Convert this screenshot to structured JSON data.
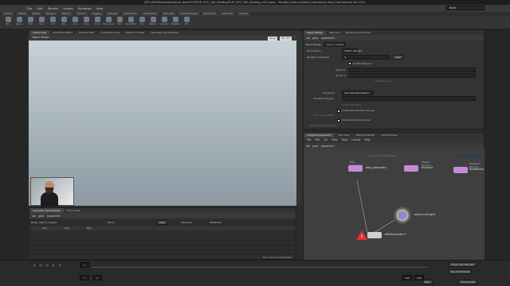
{
  "window": {
    "title": "/JETLAG/Work/sdsdn/work_files/FLIP/FLIP_020_160_Melting/FLIP_020_160_Melting_v01.hipnc - Houdini Indie Limited-Commercial Non-Commercial 16.5.311"
  },
  "menu": [
    "File",
    "Edit",
    "Render",
    "Assets",
    "Windows",
    "Help"
  ],
  "build_label": "Build",
  "shelf_tabs": [
    "Create",
    "Modify",
    "Model",
    "Polygon",
    "Deform",
    "Texture",
    "Rigging",
    "Muscles",
    "Characters",
    "Constraints",
    "Hair Utils",
    "Guide Process",
    "Terrain FX",
    "Cloud FX",
    "Volume"
  ],
  "shelf_icons": [
    "Box",
    "Sphere",
    "Tube",
    "Torus",
    "Grid",
    "Null",
    "Line",
    "Circle",
    "Curve",
    "Draw Curve",
    "Path",
    "Spray Paint",
    "Font",
    "Platonic",
    "L-System",
    "Metaball",
    "File"
  ],
  "viewport": {
    "tabs": [
      "Scene View",
      "Animation Editor",
      "Render View",
      "Composite View",
      "Motion FX View",
      "Geometry Spreadsheet"
    ],
    "path": [
      "obj",
      "geo1",
      "sopsolver1"
    ],
    "title": "Object Merge",
    "persp_label": "Persp",
    "cam_label": "No cam",
    "footer": "Non-Commercial Edition"
  },
  "params": {
    "tabs": [
      "Object Merge",
      "Take List",
      "Performance Monitor"
    ],
    "path": [
      "obj",
      "geo1",
      "sopsolver1"
    ],
    "node_type": "Object Merge",
    "node_name": "object_merge1",
    "node_name_label": "Node Name",
    "num_objects_label": "Number of Objects",
    "num_objects_value": "1",
    "clear_label": "Clear",
    "enable_merge_label": "Enable Merge 1",
    "object1_label": "Object 1",
    "group1_label": "Group 1",
    "expand_label": "Expand Group",
    "transform_label": "Transform",
    "transform_value": "Into Specified Object",
    "transform_object_label": "Transform Object",
    "invert_label": "Invert Transform",
    "create_per_prim_label": "Create Per-Primitive Groups",
    "create_prim_groups_label": "Create Primitive Groups",
    "prim_group_prefix_label": "Prim Group Prefix",
    "number_groups_label": "Number Groups Prefix"
  },
  "network": {
    "tabs": [
      "/obj/geo1/sopsolver1",
      "Tree View",
      "Material Palette",
      "Asset Browser"
    ],
    "menu": [
      "File",
      "Edit",
      "Go",
      "View",
      "Tools",
      "Layout",
      "Help"
    ],
    "path": [
      "obj",
      "geo1",
      "sopsolver1"
    ],
    "context_caption": "Non-Commercial Edition",
    "context_word": "Geometry",
    "nodes": [
      {
        "name": "dop_geometry",
        "caption": "Dop Geometry",
        "color": "#c58ad6",
        "kind": "input"
      },
      {
        "name": "impacts",
        "caption": "Impact Records",
        "color": "#c58ad6",
        "kind": "input"
      },
      {
        "name": "feedbacks",
        "caption": "Feedback Records",
        "color": "#c58ad6",
        "kind": "input"
      },
      {
        "name": "object_merge1",
        "caption": "",
        "color": "#8a8ad6",
        "kind": "merge"
      },
      {
        "name": "attribtransfer1",
        "caption": "",
        "color": "#cfcfcf",
        "kind": "error"
      }
    ]
  },
  "spreadsheet": {
    "tabs": [
      "Geometry Spreadsheet",
      "Scene View"
    ],
    "path": [
      "obj",
      "geo1",
      "sopsolver1"
    ],
    "node_label": "Node: object_merge1",
    "group_label": "Group",
    "view_label": "View",
    "intrinsics_label": "Intrinsics",
    "attributes_label": "Attributes",
    "columns": [
      "P[x]",
      "P[y]",
      "P[z]"
    ]
  },
  "timeline": {
    "current_frame": "1",
    "start": "1",
    "start_frame": "1",
    "end_frame": "240",
    "end_display": "240",
    "keys_label": "0 keys, 0/0 channels",
    "key_all_label": "Key All Channels",
    "auto_update_label": "Auto Update"
  },
  "right_strip": {
    "label": "Main"
  }
}
